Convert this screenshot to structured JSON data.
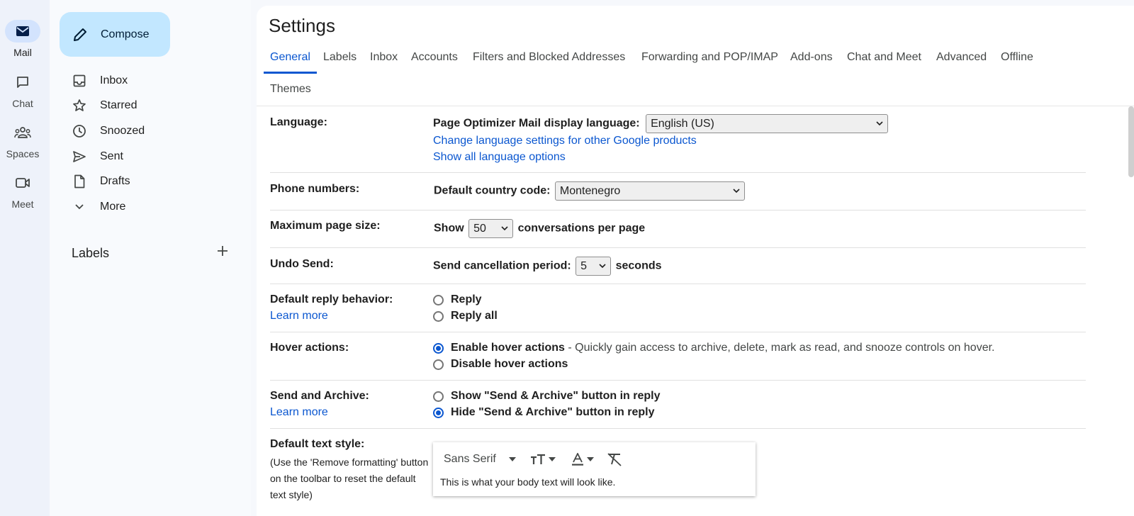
{
  "rail": [
    {
      "label": "Mail",
      "icon": "mail-icon",
      "active": true
    },
    {
      "label": "Chat",
      "icon": "chat-icon"
    },
    {
      "label": "Spaces",
      "icon": "spaces-icon"
    },
    {
      "label": "Meet",
      "icon": "meet-icon"
    }
  ],
  "nav": {
    "compose_label": "Compose",
    "items": [
      {
        "label": "Inbox",
        "icon": "inbox-icon"
      },
      {
        "label": "Starred",
        "icon": "star-icon"
      },
      {
        "label": "Snoozed",
        "icon": "clock-icon"
      },
      {
        "label": "Sent",
        "icon": "send-icon"
      },
      {
        "label": "Drafts",
        "icon": "draft-icon"
      },
      {
        "label": "More",
        "icon": "chevron-down-icon"
      }
    ],
    "labels_heading": "Labels"
  },
  "settings": {
    "title": "Settings",
    "tabs": [
      "General",
      "Labels",
      "Inbox",
      "Accounts",
      "Filters and Blocked Addresses",
      "Forwarding and POP/IMAP",
      "Add-ons",
      "Chat and Meet",
      "Advanced",
      "Offline",
      "Themes"
    ],
    "active_tab": "General",
    "language": {
      "label": "Language:",
      "prompt": "Page Optimizer Mail display language:",
      "value": "English (US)",
      "link1": "Change language settings for other Google products",
      "link2": "Show all language options"
    },
    "phone": {
      "label": "Phone numbers:",
      "prompt": "Default country code:",
      "value": "Montenegro"
    },
    "page_size": {
      "label": "Maximum page size:",
      "prefix": "Show",
      "value": "50",
      "suffix": "conversations per page"
    },
    "undo_send": {
      "label": "Undo Send:",
      "prompt": "Send cancellation period:",
      "value": "5",
      "suffix": "seconds"
    },
    "reply": {
      "label": "Default reply behavior:",
      "learn_more": "Learn more",
      "options": [
        "Reply",
        "Reply all"
      ],
      "selected": null
    },
    "hover": {
      "label": "Hover actions:",
      "enable": "Enable hover actions",
      "enable_desc": "- Quickly gain access to archive, delete, mark as read, and snooze controls on hover.",
      "disable": "Disable hover actions",
      "selected": "enable"
    },
    "send_archive": {
      "label": "Send and Archive:",
      "learn_more": "Learn more",
      "show": "Show \"Send & Archive\" button in reply",
      "hide": "Hide \"Send & Archive\" button in reply",
      "selected": "hide"
    },
    "text_style": {
      "label": "Default text style:",
      "note": "(Use the 'Remove formatting' button on the toolbar to reset the default text style)",
      "font": "Sans Serif",
      "preview": "This is what your body text will look like."
    }
  }
}
